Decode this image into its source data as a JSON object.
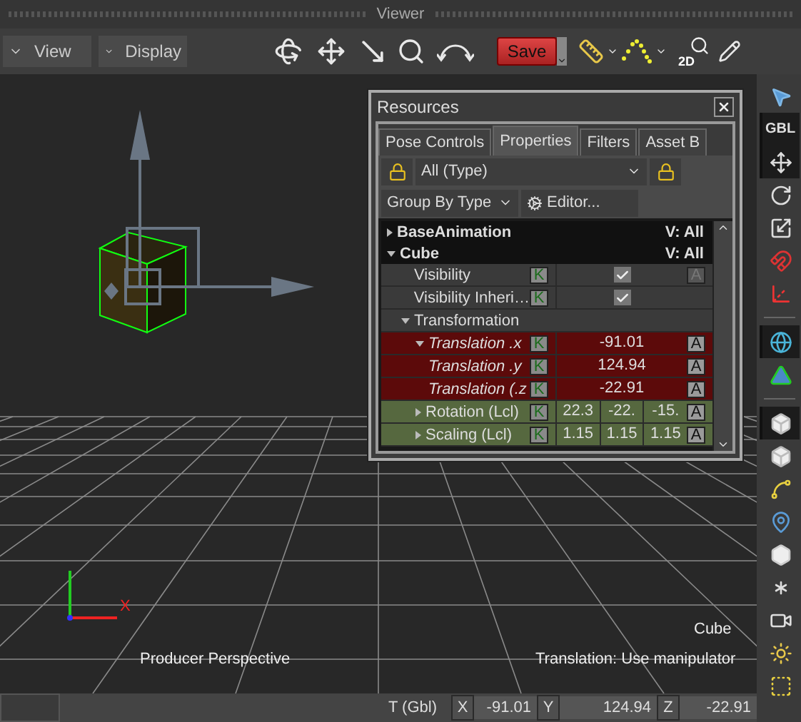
{
  "window": {
    "title": "Viewer"
  },
  "toolbar": {
    "menus": [
      {
        "label": "View"
      },
      {
        "label": "Display"
      }
    ],
    "save_label": "Save",
    "zoom_2d_label": "2D"
  },
  "viewport": {
    "axis_label": "X",
    "selection_label": "Cube",
    "camera_label": "Producer Perspective",
    "hint": "Translation: Use manipulator"
  },
  "resources": {
    "title": "Resources",
    "tabs": [
      {
        "label": "Pose Controls",
        "selected": false
      },
      {
        "label": "Properties",
        "selected": true
      },
      {
        "label": "Filters",
        "selected": false
      },
      {
        "label": "Asset B",
        "selected": false
      }
    ],
    "type_filter": "All (Type)",
    "group_by": "Group By Type",
    "editor": "Editor...",
    "tree": [
      {
        "kind": "object",
        "label": "BaseAnimation",
        "visibility": "V: All",
        "expanded": false
      },
      {
        "kind": "object",
        "label": "Cube",
        "visibility": "V: All",
        "expanded": true,
        "children": [
          {
            "kind": "property",
            "label": "Visibility",
            "key": "K",
            "checked": true,
            "anim": "A",
            "anim_disabled": true
          },
          {
            "kind": "property",
            "label": "Visibility Inheri…",
            "key": "K",
            "checked": true
          },
          {
            "kind": "group",
            "label": "Transformation",
            "expanded": true,
            "children": [
              {
                "kind": "property",
                "label": "Translation .x",
                "expanded": true,
                "animated": true,
                "color": "#5c0a0a",
                "key": "K",
                "value": "-91.01",
                "anim": "A",
                "anim_disabled": false
              },
              {
                "kind": "property",
                "label": "Translation .y",
                "animated": true,
                "color": "#5c0a0a",
                "key": "K",
                "value": "124.94",
                "anim": "A",
                "anim_disabled": false
              },
              {
                "kind": "property",
                "label": "Translation (.z",
                "animated": true,
                "color": "#5c0a0a",
                "key": "K",
                "value": "-22.91",
                "anim": "A",
                "anim_disabled": false
              },
              {
                "kind": "property",
                "label": "Rotation (Lcl)",
                "expanded": false,
                "animated": false,
                "color": "#56683f",
                "key": "K",
                "values": [
                  "22.3",
                  "-22.",
                  "-15."
                ],
                "anim": "A",
                "anim_disabled": false
              },
              {
                "kind": "property",
                "label": "Scaling (Lcl)",
                "expanded": false,
                "animated": false,
                "color": "#56683f",
                "key": "K",
                "values": [
                  "1.15",
                  "1.15",
                  "1.15"
                ],
                "anim": "A",
                "anim_disabled": false
              }
            ]
          }
        ]
      }
    ]
  },
  "tool_groups": [
    [
      {
        "kind": "select",
        "selected": false
      },
      {
        "kind": "space",
        "label": "GBL",
        "selected": true
      },
      {
        "kind": "translate",
        "selected": true
      },
      {
        "kind": "rotate",
        "selected": false
      },
      {
        "kind": "scale",
        "selected": false
      },
      {
        "kind": "magnet",
        "selected": false
      },
      {
        "kind": "pivot",
        "selected": false
      }
    ],
    [
      {
        "kind": "globe",
        "selected": true
      },
      {
        "kind": "shape",
        "selected": false
      }
    ],
    [
      {
        "kind": "box",
        "selected": true
      },
      {
        "kind": "box",
        "selected": false
      },
      {
        "kind": "curve",
        "selected": false
      },
      {
        "kind": "joint",
        "selected": false
      },
      {
        "kind": "hexagon",
        "selected": false
      },
      {
        "kind": "null",
        "selected": false
      },
      {
        "kind": "camera",
        "selected": false
      },
      {
        "kind": "light",
        "selected": false
      },
      {
        "kind": "marker",
        "selected": false
      }
    ]
  ],
  "status_bar": {
    "label": "T (Gbl)",
    "fields": [
      {
        "axis": "X",
        "value": "-91.01"
      },
      {
        "axis": "Y",
        "value": "124.94"
      },
      {
        "axis": "Z",
        "value": "-22.91"
      }
    ]
  }
}
